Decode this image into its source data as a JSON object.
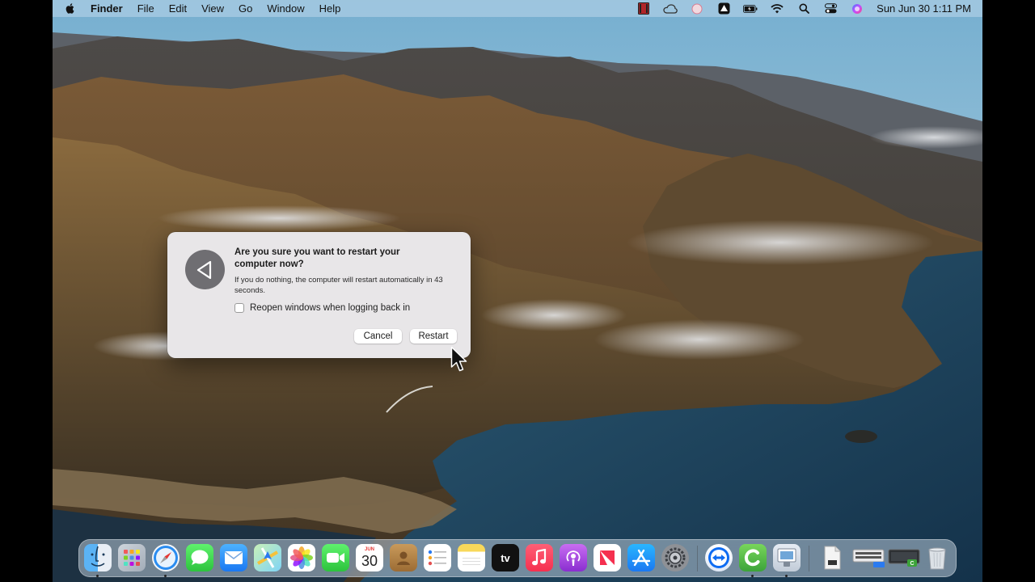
{
  "menubar": {
    "app_name": "Finder",
    "menus": [
      "File",
      "Edit",
      "View",
      "Go",
      "Window",
      "Help"
    ],
    "status_icons": [
      "screen-recorder-icon",
      "creative-cloud-icon",
      "siri-small-icon",
      "vectorworks-icon",
      "battery-icon",
      "wifi-icon",
      "spotlight-search-icon",
      "control-center-icon",
      "siri-icon"
    ],
    "clock": "Sun Jun 30  1:11 PM"
  },
  "dialog": {
    "title": "Are you sure you want to restart your computer now?",
    "message": "If you do nothing, the computer will restart automatically in 43 seconds.",
    "checkbox_label": "Reopen windows when logging back in",
    "checkbox_checked": false,
    "cancel_label": "Cancel",
    "restart_label": "Restart"
  },
  "dock": {
    "apps": [
      {
        "name": "Finder",
        "icon": "finder-icon",
        "running": true
      },
      {
        "name": "Launchpad",
        "icon": "launchpad-icon",
        "running": false
      },
      {
        "name": "Safari",
        "icon": "safari-icon",
        "running": true
      },
      {
        "name": "Messages",
        "icon": "messages-icon",
        "running": false
      },
      {
        "name": "Mail",
        "icon": "mail-icon",
        "running": false
      },
      {
        "name": "Maps",
        "icon": "maps-icon",
        "running": false
      },
      {
        "name": "Photos",
        "icon": "photos-icon",
        "running": false
      },
      {
        "name": "FaceTime",
        "icon": "facetime-icon",
        "running": false
      },
      {
        "name": "Calendar",
        "icon": "calendar-icon",
        "running": false,
        "month": "JUN",
        "day": "30"
      },
      {
        "name": "Contacts",
        "icon": "contacts-icon",
        "running": false
      },
      {
        "name": "Reminders",
        "icon": "reminders-icon",
        "running": false
      },
      {
        "name": "Notes",
        "icon": "notes-icon",
        "running": false
      },
      {
        "name": "TV",
        "icon": "apple-tv-icon",
        "running": false,
        "label": "tv"
      },
      {
        "name": "Music",
        "icon": "music-icon",
        "running": false
      },
      {
        "name": "Podcasts",
        "icon": "podcasts-icon",
        "running": false
      },
      {
        "name": "News",
        "icon": "news-icon",
        "running": false
      },
      {
        "name": "App Store",
        "icon": "app-store-icon",
        "running": false
      },
      {
        "name": "System Preferences",
        "icon": "system-preferences-icon",
        "running": false
      },
      {
        "name": "TeamViewer",
        "icon": "teamviewer-icon",
        "running": false
      },
      {
        "name": "Camtasia",
        "icon": "camtasia-icon",
        "running": true
      },
      {
        "name": "Preview",
        "icon": "preview-icon",
        "running": true
      }
    ],
    "stack_items": [
      {
        "name": "Document",
        "icon": "document-icon"
      },
      {
        "name": "Keyboard Utility",
        "icon": "keyboard-icon"
      },
      {
        "name": "Recording",
        "icon": "screen-recording-icon"
      },
      {
        "name": "Trash",
        "icon": "trash-icon"
      }
    ]
  },
  "colors": {
    "dialog_bg": "#e8e6e8",
    "menubar_bg": "#bed7eb",
    "dock_bg": "#b9c8d7"
  }
}
